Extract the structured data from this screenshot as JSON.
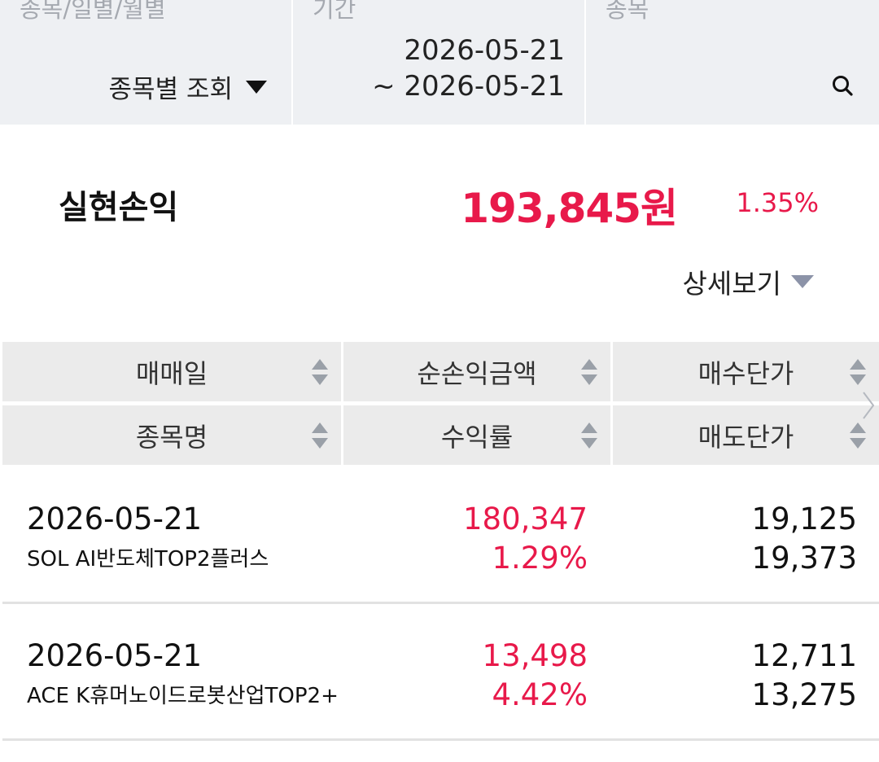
{
  "filter": {
    "type_label": "종목/일별/월별",
    "type_value": "종목별 조회",
    "period_label": "기간",
    "period_start": "2026-05-21",
    "period_end": "~ 2026-05-21",
    "stock_label": "종목",
    "search_icon": "search-icon"
  },
  "summary": {
    "label": "실현손익",
    "amount": "193,845원",
    "rate": "1.35%",
    "detail_label": "상세보기"
  },
  "table": {
    "headers_row1": [
      "매매일",
      "순손익금액",
      "매수단가"
    ],
    "headers_row2": [
      "종목명",
      "수익률",
      "매도단가"
    ],
    "rows": [
      {
        "date": "2026-05-21",
        "name": "SOL AI반도체TOP2플러스",
        "profit": "180,347",
        "rate": "1.29%",
        "buy_price": "19,125",
        "sell_price": "19,373"
      },
      {
        "date": "2026-05-21",
        "name": "ACE K휴머노이드로봇산업TOP2+",
        "profit": "13,498",
        "rate": "4.42%",
        "buy_price": "12,711",
        "sell_price": "13,275"
      }
    ]
  },
  "colors": {
    "accent_red": "#e8194a",
    "header_bg": "#eef0f3",
    "table_header_bg": "#ebebeb"
  }
}
